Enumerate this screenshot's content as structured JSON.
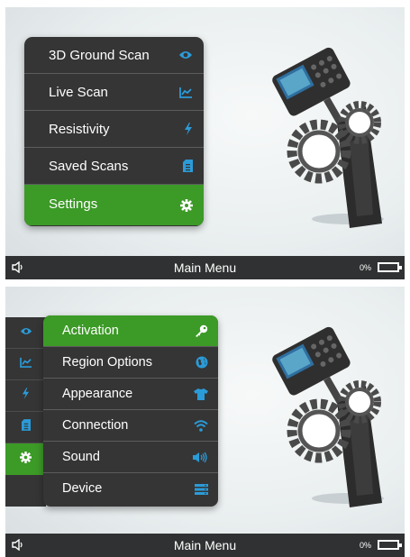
{
  "screen_main": {
    "menu": [
      {
        "label": "3D Ground Scan",
        "icon": "eye-icon"
      },
      {
        "label": "Live Scan",
        "icon": "chart-icon"
      },
      {
        "label": "Resistivity",
        "icon": "lightning-icon"
      },
      {
        "label": "Saved Scans",
        "icon": "sd-card-icon"
      },
      {
        "label": "Settings",
        "icon": "gear-icon",
        "active": true
      }
    ],
    "status": {
      "title": "Main Menu",
      "battery": "0%"
    }
  },
  "screen_settings": {
    "sidebar": [
      "eye-icon",
      "chart-icon",
      "lightning-icon",
      "sd-card-icon",
      "gear-icon"
    ],
    "menu": [
      {
        "label": "Activation",
        "icon": "key-icon",
        "active": true
      },
      {
        "label": "Region Options",
        "icon": "globe-icon"
      },
      {
        "label": "Appearance",
        "icon": "shirt-icon"
      },
      {
        "label": "Connection",
        "icon": "wifi-icon"
      },
      {
        "label": "Sound",
        "icon": "speaker-icon"
      },
      {
        "label": "Device",
        "icon": "device-list-icon"
      }
    ],
    "status": {
      "title": "Main Menu",
      "battery": "0%"
    }
  },
  "colors": {
    "accent_green": "#3c9a27",
    "menu_bg": "#353535",
    "icon_blue": "#2b9bd8"
  }
}
